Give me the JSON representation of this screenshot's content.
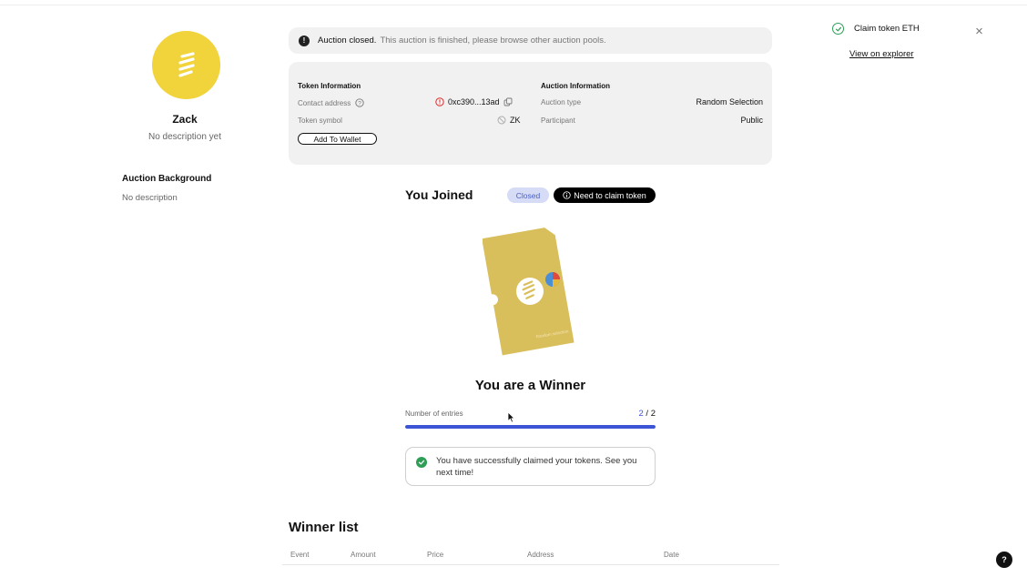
{
  "profile": {
    "name": "Zack",
    "description": "No description yet",
    "avatar_color": "#f1d33c",
    "background_title": "Auction Background",
    "background_desc": "No description"
  },
  "alert": {
    "icon": "exclamation-icon",
    "title": "Auction closed.",
    "message": "This auction is finished, please browse other auction pools."
  },
  "token_info": {
    "title": "Token Information",
    "contract_label": "Contact address",
    "contract_value": "0xc390...13ad",
    "symbol_label": "Token symbol",
    "symbol_value": "ZK",
    "add_wallet": "Add To Wallet"
  },
  "auction_info": {
    "title": "Auction Information",
    "type_label": "Auction type",
    "type_value": "Random Selection",
    "participant_label": "Participant",
    "participant_value": "Public"
  },
  "joined": {
    "title": "You Joined",
    "status_badge": "Closed",
    "claim_badge": "Need to claim token"
  },
  "result": {
    "title": "You are a Winner",
    "entries_label": "Number of entries",
    "entries_current": "2",
    "entries_sep": "/",
    "entries_total": "2",
    "progress_fraction": 1.0,
    "success_message": "You have successfully claimed your tokens. See you next time!"
  },
  "winner_list": {
    "title": "Winner list",
    "columns": [
      "Event",
      "Amount",
      "Price",
      "Address",
      "Date"
    ]
  },
  "toast": {
    "title": "Claim token ETH",
    "link": "View on explorer"
  },
  "help": {
    "label": "?"
  },
  "colors": {
    "accent": "#3b55d6",
    "success": "#2e9e57",
    "ticket": "#d9be5c"
  }
}
